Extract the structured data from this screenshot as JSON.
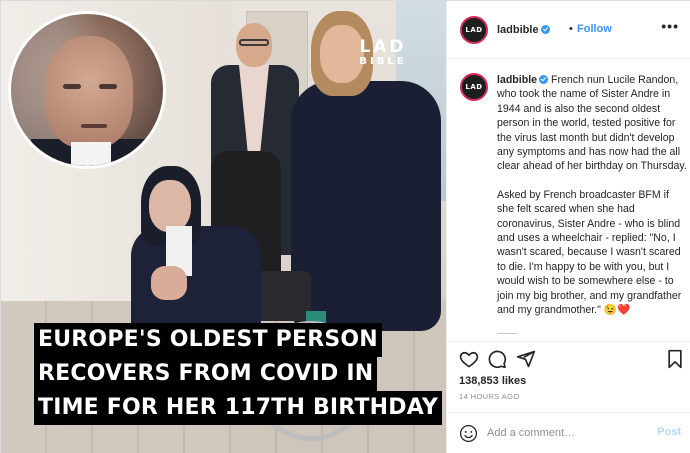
{
  "photo": {
    "logo_line1": "LAD",
    "logo_line2": "BIBLE",
    "headline_lines": [
      "EUROPE'S OLDEST PERSON",
      "RECOVERS FROM COVID IN",
      "TIME FOR HER 117TH BIRTHDAY"
    ]
  },
  "post": {
    "avatar_text": "LAD",
    "username": "ladbible",
    "separator": "•",
    "follow_label": "Follow",
    "more_label": "•••",
    "caption_paragraphs": [
      "French nun Lucile Randon, who took the name of Sister Andre in 1944 and is also the second oldest person in the world, tested positive for the virus last month but didn't develop any symptoms and has now had the all clear ahead of her birthday on Thursday.",
      "Asked by French broadcaster BFM if she felt scared when she had coronavirus, Sister Andre - who is blind and uses a wheelchair - replied: \"No, I wasn't scared, because I wasn't scared to die. I'm happy to be with you, but I would wish to be somewhere else - to join my big brother, and my grandfather and my grandmother.\" 😉❤️"
    ],
    "likes": "138,853 likes",
    "timestamp": "14 HOURS AGO",
    "comment_placeholder": "Add a comment…",
    "post_label": "Post"
  },
  "colors": {
    "follow_blue": "#3897f0",
    "verified_blue": "#3897f0",
    "post_disabled": "#b3dbff",
    "avatar_ring": "#d72a5a"
  },
  "icons": [
    "heart-icon",
    "comment-icon",
    "share-icon",
    "bookmark-icon",
    "emoji-icon",
    "verified-badge-icon"
  ]
}
